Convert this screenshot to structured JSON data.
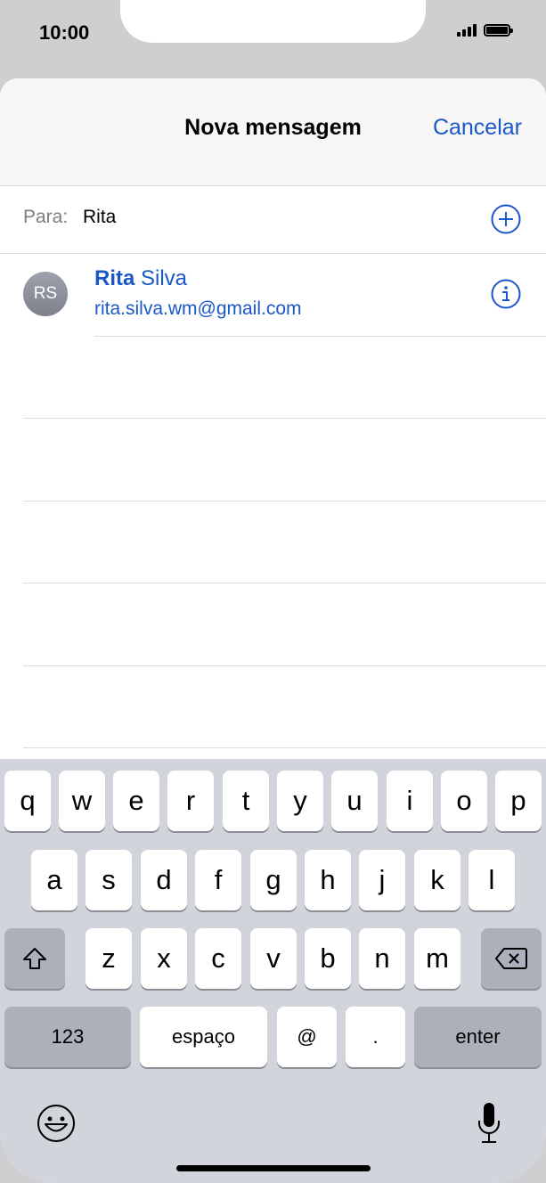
{
  "status": {
    "time": "10:00"
  },
  "nav": {
    "title": "Nova mensagem",
    "cancel": "Cancelar"
  },
  "to": {
    "label": "Para:",
    "value": "Rita"
  },
  "suggestion": {
    "initials": "RS",
    "name_match": "Rita",
    "name_rest": " Silva",
    "email": "rita.silva.wm@gmail.com"
  },
  "keyboard": {
    "row1": [
      "q",
      "w",
      "e",
      "r",
      "t",
      "y",
      "u",
      "i",
      "o",
      "p"
    ],
    "row2": [
      "a",
      "s",
      "d",
      "f",
      "g",
      "h",
      "j",
      "k",
      "l"
    ],
    "row3": [
      "z",
      "x",
      "c",
      "v",
      "b",
      "n",
      "m"
    ],
    "numbers_label": "123",
    "space_label": "espaço",
    "at_label": "@",
    "dot_label": ".",
    "enter_label": "enter"
  },
  "colors": {
    "accent": "#1a57c9",
    "keyboard_bg": "#d1d4db"
  }
}
